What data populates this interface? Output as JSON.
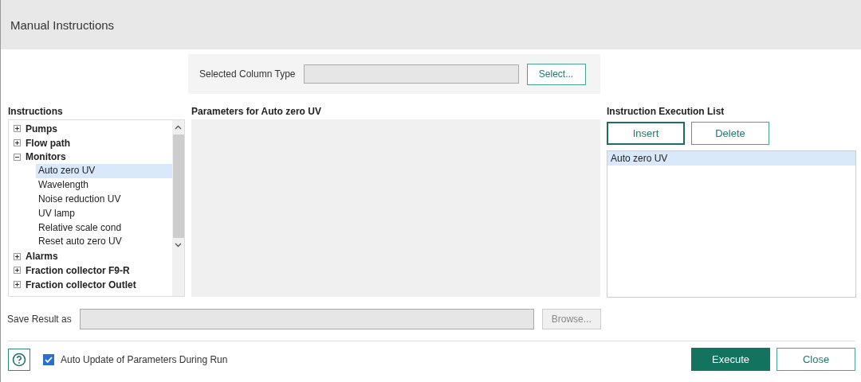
{
  "window": {
    "title": "Manual Instructions"
  },
  "column_type": {
    "label": "Selected Column Type",
    "button": "Select..."
  },
  "instructions": {
    "heading": "Instructions",
    "items": [
      {
        "label": "Pumps",
        "expanded": false
      },
      {
        "label": "Flow path",
        "expanded": false
      },
      {
        "label": "Monitors",
        "expanded": true,
        "children": [
          {
            "label": "Auto zero UV",
            "selected": true
          },
          {
            "label": "Wavelength",
            "selected": false
          },
          {
            "label": "Noise reduction UV",
            "selected": false
          },
          {
            "label": "UV lamp",
            "selected": false
          },
          {
            "label": "Relative scale cond",
            "selected": false
          },
          {
            "label": "Reset auto zero UV",
            "selected": false
          }
        ]
      },
      {
        "label": "Alarms",
        "expanded": false
      },
      {
        "label": "Fraction collector F9-R",
        "expanded": false
      },
      {
        "label": "Fraction collector Outlet",
        "expanded": false
      }
    ]
  },
  "parameters": {
    "heading": "Parameters for Auto zero UV"
  },
  "execution_list": {
    "heading": "Instruction Execution List",
    "buttons": [
      "Insert",
      "Delete"
    ],
    "items": [
      {
        "label": "Auto zero UV",
        "selected": true
      }
    ]
  },
  "save_result": {
    "label": "Save Result as",
    "button": "Browse...",
    "button_disabled": true
  },
  "auto_update": {
    "label": "Auto Update of Parameters During Run",
    "checked": true
  },
  "buttons": [
    "Execute",
    "Close"
  ]
}
